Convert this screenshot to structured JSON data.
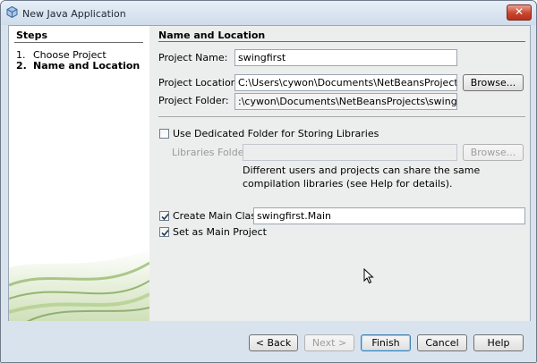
{
  "window": {
    "title": "New Java Application",
    "close_label": "✕"
  },
  "steps": {
    "heading": "Steps",
    "items": [
      {
        "num": "1.",
        "label": "Choose Project"
      },
      {
        "num": "2.",
        "label": "Name and Location"
      }
    ]
  },
  "form": {
    "heading": "Name and Location",
    "project_name": {
      "label": "Project Name:",
      "value": "swingfirst"
    },
    "project_location": {
      "label": "Project Location:",
      "value": "C:\\Users\\cywon\\Documents\\NetBeansProjects",
      "browse_label": "Browse..."
    },
    "project_folder": {
      "label": "Project Folder:",
      "value": ":\\cywon\\Documents\\NetBeansProjects\\swingfirst"
    },
    "dedicated_folder": {
      "label": "Use Dedicated Folder for Storing Libraries",
      "checked": false
    },
    "libraries_folder": {
      "label": "Libraries Folder:",
      "value": "",
      "browse_label": "Browse..."
    },
    "libraries_note": "Different users and projects can share the same compilation libraries (see Help for details).",
    "create_main_class": {
      "label": "Create Main Class",
      "checked": true,
      "value": "swingfirst.Main"
    },
    "set_main_project": {
      "label": "Set as Main Project",
      "checked": true
    }
  },
  "buttons": {
    "back": "< Back",
    "next": "Next >",
    "finish": "Finish",
    "cancel": "Cancel",
    "help": "Help"
  },
  "colors": {
    "title_bar": "#cfdcea",
    "close_button": "#c9452e",
    "panel_bg": "#eceded",
    "accent_green": "#5f8f2f"
  },
  "icons": [
    "app-icon",
    "close-icon",
    "check-icon",
    "mouse-pointer-icon",
    "decorative-swoosh"
  ]
}
